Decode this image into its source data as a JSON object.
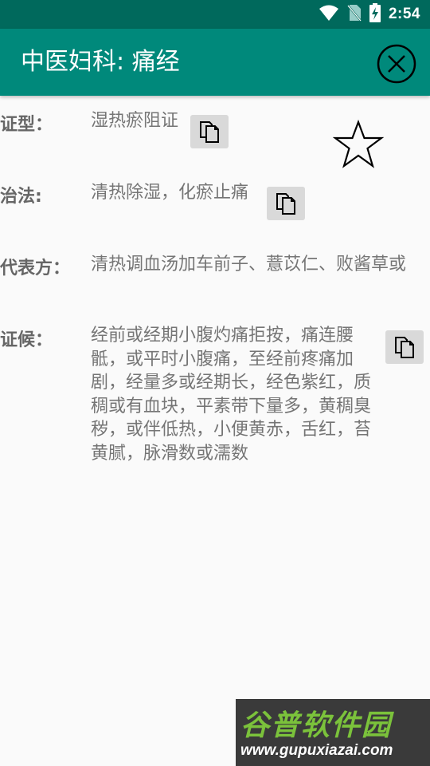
{
  "status_bar": {
    "time": "2:54",
    "icons": [
      "wifi-icon",
      "no-sim-icon",
      "battery-charging-icon"
    ]
  },
  "app_bar": {
    "title": "中医妇科: 痛经",
    "close_icon": "close-circle-icon"
  },
  "rows": {
    "pattern": {
      "label": "证型：",
      "value": "湿热瘀阻证"
    },
    "treatment": {
      "label": "治法:",
      "value": "清热除湿，化瘀止痛"
    },
    "formula": {
      "label": "代表方：",
      "value": "清热调血汤加车前子、薏苡仁、败酱草或"
    },
    "symptoms": {
      "label": "证候：",
      "value": "经前或经期小腹灼痛拒按，痛连腰骶，或平时小腹痛，至经前疼痛加剧，经量多或经期长，经色紫红，质稠或有血块，平素带下量多，黄稠臭秽，或伴低热，小便黄赤，舌红，苔黄腻，脉滑数或濡数"
    }
  },
  "icons": {
    "copy": "copy-icon",
    "favorite": "star-outline-icon"
  },
  "watermark": {
    "main": "谷普软件园",
    "sub": "www.gupuxiazai.com"
  },
  "colors": {
    "status_bar": "#00695c",
    "app_bar": "#00897b",
    "background": "#fafafa",
    "label": "#666666",
    "value": "#757575",
    "copy_button_bg": "#d9d9d9",
    "watermark_green": "#7bc23b"
  }
}
